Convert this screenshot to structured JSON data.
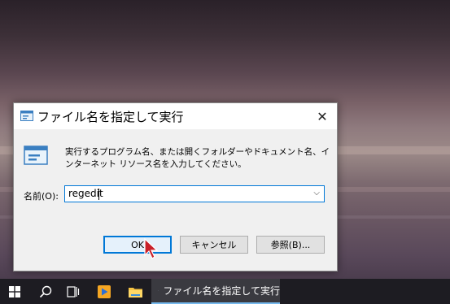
{
  "dialog": {
    "title": "ファイル名を指定して実行",
    "description": "実行するプログラム名、または開くフォルダーやドキュメント名、インターネット リソース名を入力してください。",
    "open_label": "名前(O):",
    "open_value": "regedit",
    "buttons": {
      "ok": "OK",
      "cancel": "キャンセル",
      "browse": "参照(B)..."
    },
    "close_glyph": "✕",
    "dropdown_glyph": "⌵"
  },
  "taskbar": {
    "active_task_label": "ファイル名を指定して実行",
    "icons": [
      "windows-start-icon",
      "search-icon",
      "task-view-icon",
      "media-player-icon",
      "file-explorer-icon",
      "run-icon"
    ]
  },
  "colors": {
    "accent": "#0078d7",
    "taskbar": "#1d1c22",
    "dialog_bg": "#f0f0f0"
  }
}
